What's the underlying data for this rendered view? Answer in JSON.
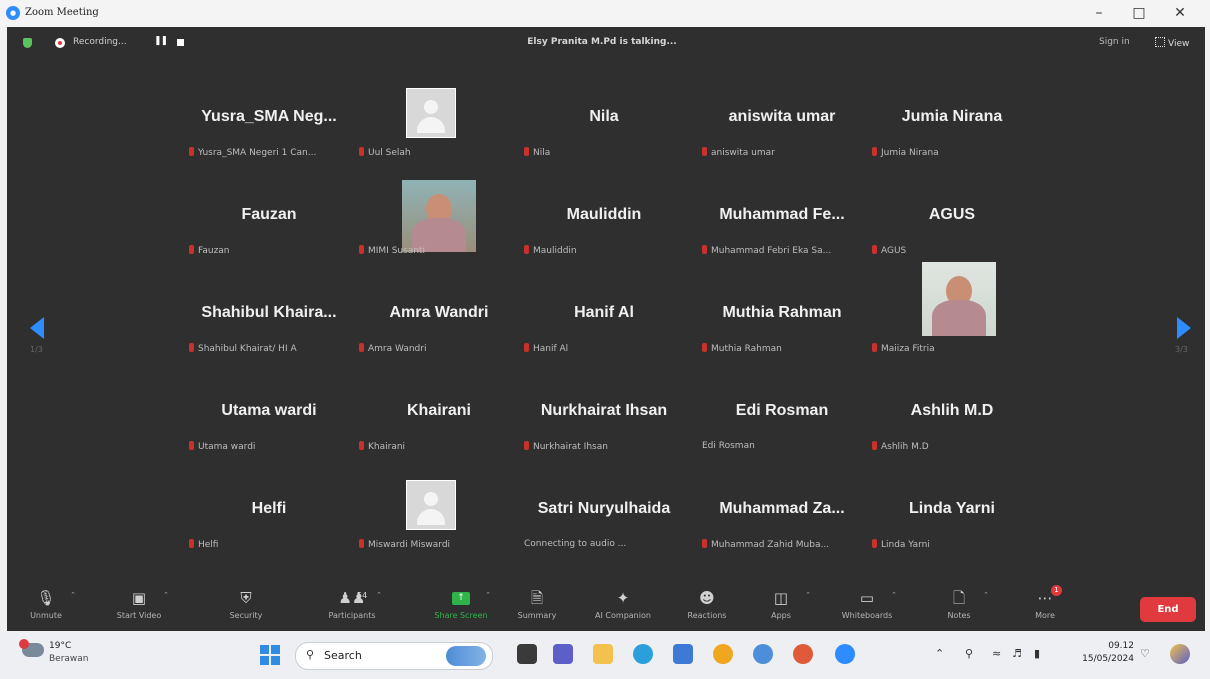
{
  "window": {
    "app_title": "Zoom Meeting",
    "logo_icon": "zoom-logo-icon",
    "controls": {
      "minimize": "–",
      "maximize": "□",
      "close": "✕"
    }
  },
  "topbar": {
    "recording_label": "Recording...",
    "pause_label": "❚❚",
    "talking_text": "Elsy Pranita M.Pd is talking...",
    "sign_in": "Sign in",
    "view_label": "View"
  },
  "participants": [
    {
      "name": "Yusra_SMA Neg...",
      "label": "Yusra_SMA Negeri 1 Can...",
      "muted": true
    },
    {
      "name": "",
      "label": "Uul Selah",
      "muted": true,
      "avatar": "placeholder"
    },
    {
      "name": "Nila",
      "label": "Nila",
      "muted": true
    },
    {
      "name": "aniswita umar",
      "label": "aniswita umar",
      "muted": true
    },
    {
      "name": "Jumia Nirana",
      "label": "Jumia Nirana",
      "muted": true
    },
    {
      "name": "Fauzan",
      "label": "Fauzan",
      "muted": true
    },
    {
      "name": "",
      "label": "MIMI Susanti",
      "muted": true,
      "avatar": "video"
    },
    {
      "name": "Mauliddin",
      "label": "Mauliddin",
      "muted": true
    },
    {
      "name": "Muhammad Fe...",
      "label": "Muhammad Febri Eka Sa...",
      "muted": true
    },
    {
      "name": "AGUS",
      "label": "AGUS",
      "muted": true
    },
    {
      "name": "Shahibul Khaira...",
      "label": "Shahibul Khairat/ HI A",
      "muted": true
    },
    {
      "name": "Amra Wandri",
      "label": "Amra Wandri",
      "muted": true
    },
    {
      "name": "Hanif Al",
      "label": "Hanif Al",
      "muted": true
    },
    {
      "name": "Muthia Rahman",
      "label": "Muthia Rahman",
      "muted": true
    },
    {
      "name": "",
      "label": "Maiiza Fitria",
      "muted": true,
      "avatar": "video"
    },
    {
      "name": "Utama wardi",
      "label": "Utama wardi",
      "muted": true
    },
    {
      "name": "Khairani",
      "label": "Khairani",
      "muted": true
    },
    {
      "name": "Nurkhairat Ihsan",
      "label": "Nurkhairat Ihsan",
      "muted": true
    },
    {
      "name": "Edi Rosman",
      "label": "Edi Rosman",
      "muted": false
    },
    {
      "name": "Ashlih M.D",
      "label": "Ashlih M.D",
      "muted": true
    },
    {
      "name": "Helfi",
      "label": "Helfi",
      "muted": true
    },
    {
      "name": "",
      "label": "Miswardi Miswardi",
      "muted": true,
      "avatar": "placeholder"
    },
    {
      "name": "Satri Nuryulhaida",
      "label": "Connecting to audio ...",
      "muted": false
    },
    {
      "name": "Muhammad Za...",
      "label": "Muhammad Zahid Muba...",
      "muted": true
    },
    {
      "name": "Linda Yarni",
      "label": "Linda Yarni",
      "muted": true
    }
  ],
  "pagination": {
    "left": "1/3",
    "right": "3/3"
  },
  "toolbar": {
    "unmute": "Unmute",
    "start_video": "Start Video",
    "security": "Security",
    "participants": "Participants",
    "participant_count": "54",
    "share_screen": "Share Screen",
    "summary": "Summary",
    "ai_companion": "AI Companion",
    "reactions": "Reactions",
    "apps": "Apps",
    "whiteboards": "Whiteboards",
    "notes": "Notes",
    "more": "More",
    "more_badge": "1",
    "end": "End"
  },
  "taskbar": {
    "weather_temp": "19°C",
    "weather_desc": "Berawan",
    "search_placeholder": "Search",
    "time": "09.12",
    "date": "15/05/2024"
  },
  "colors": {
    "accent": "#2d8cff",
    "danger": "#e0393e",
    "share": "#2fb44a",
    "meeting_bg": "#2f2f2f"
  }
}
